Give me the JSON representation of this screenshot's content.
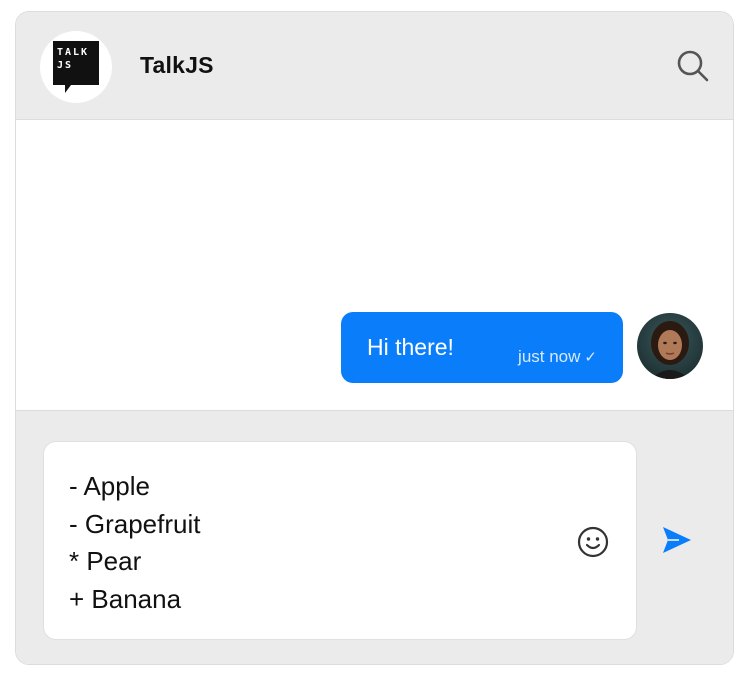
{
  "header": {
    "logo_text_line1": "TALK",
    "logo_text_line2": "JS",
    "title": "TalkJS",
    "search_icon": "search-icon"
  },
  "messages": [
    {
      "text": "Hi there!",
      "time": "just now",
      "status_icon": "check-icon",
      "sender_avatar": "avatar-woman"
    }
  ],
  "composer": {
    "lines": [
      "- Apple",
      "- Grapefruit",
      "* Pear",
      "+ Banana"
    ],
    "emoji_icon": "smiley-icon",
    "send_icon": "send-icon"
  },
  "colors": {
    "accent": "#0a7efa",
    "header_bg": "#ebebeb",
    "footer_bg": "#ebebeb",
    "text": "#111111"
  }
}
